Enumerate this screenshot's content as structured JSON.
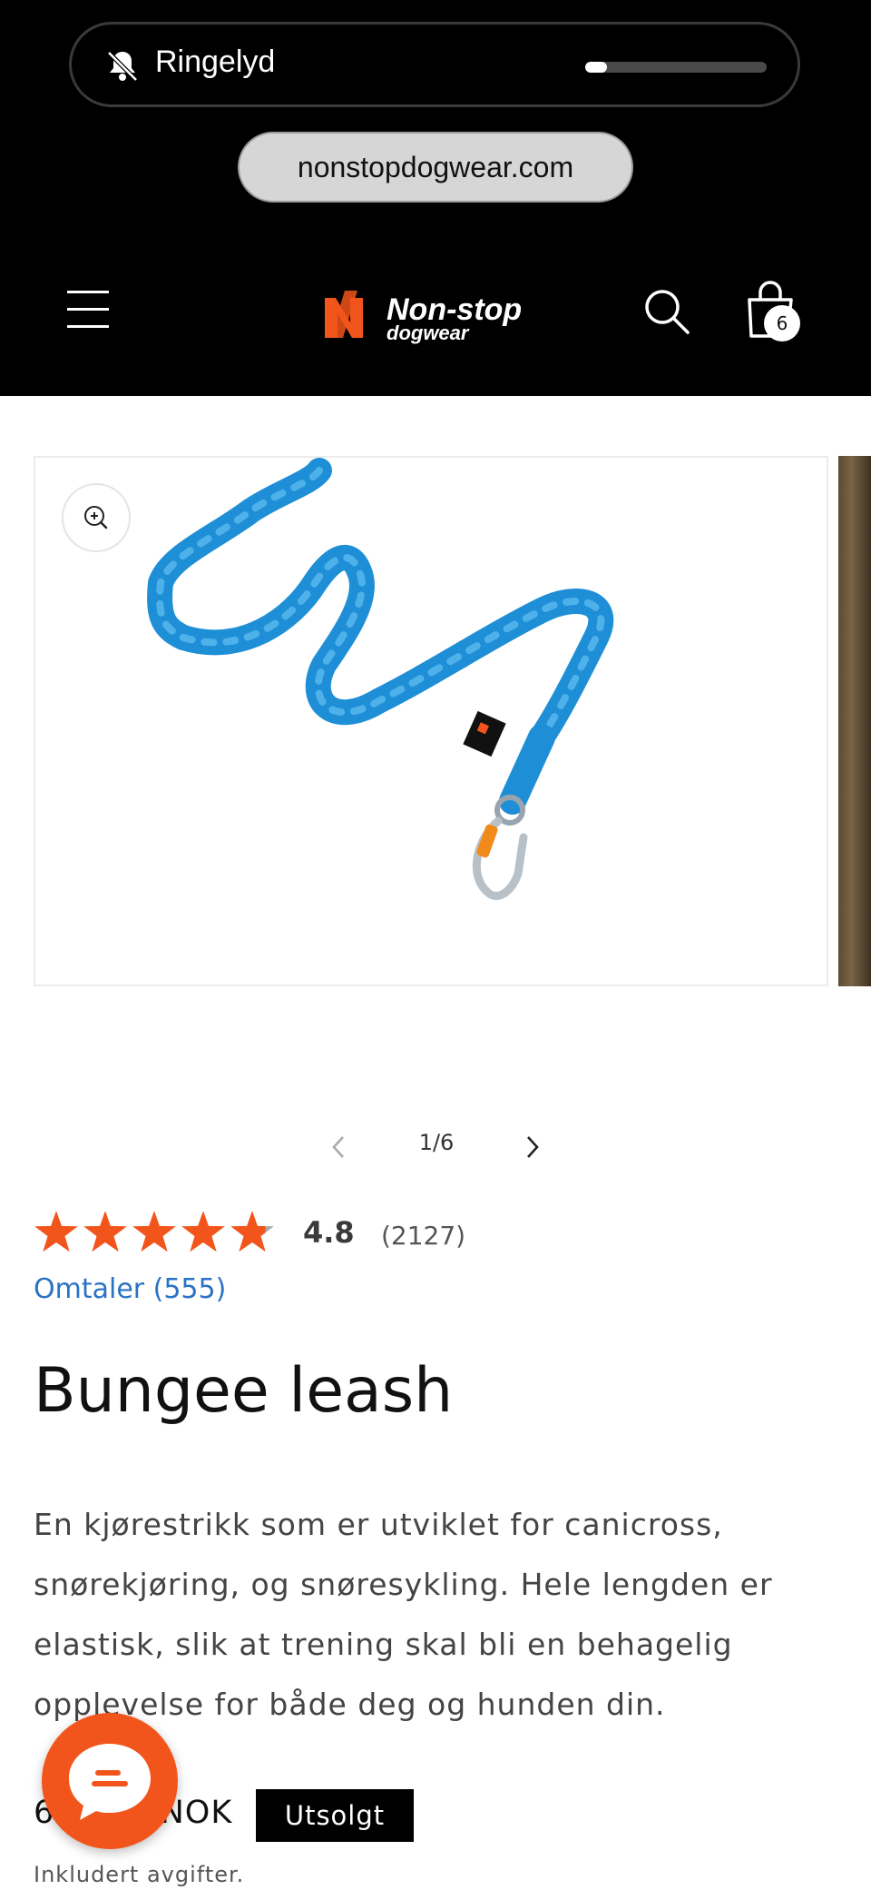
{
  "status_overlay": {
    "ringer_label": "Ringelyd",
    "ringer_icon": "bell-slash-icon",
    "volume_level": 0.12
  },
  "browser": {
    "url": "nonstopdogwear.com"
  },
  "header": {
    "menu_icon": "hamburger-menu-icon",
    "logo_text_main": "Non-stop",
    "logo_text_sub": "dogwear",
    "search_icon": "search-icon",
    "cart_icon": "shopping-bag-icon",
    "cart_count": "6",
    "brand_color": "#f2551b"
  },
  "gallery": {
    "zoom_icon": "zoom-in-icon",
    "counter": "1/6",
    "prev_icon": "chevron-left-icon",
    "next_icon": "chevron-right-icon",
    "leash_color": "#1e8fd6"
  },
  "product": {
    "rating_value": "4.8",
    "rating_count": "(2127)",
    "star_fraction": 4.8,
    "star_color": "#f2551b",
    "reviews_link": "Omtaler (555)",
    "title": "Bungee leash",
    "description": "En kjørestrikk som er utviklet for canicross, snørekjøring, og snøresykling. Hele lengden er elastisk, slik at trening skal bli en behagelig opplevelse for både deg og hunden din.",
    "price": "64    NOK",
    "soldout_label": "Utsolgt",
    "taxes_note": "Inkludert avgifter."
  },
  "chat": {
    "icon": "chat-bubble-icon"
  }
}
